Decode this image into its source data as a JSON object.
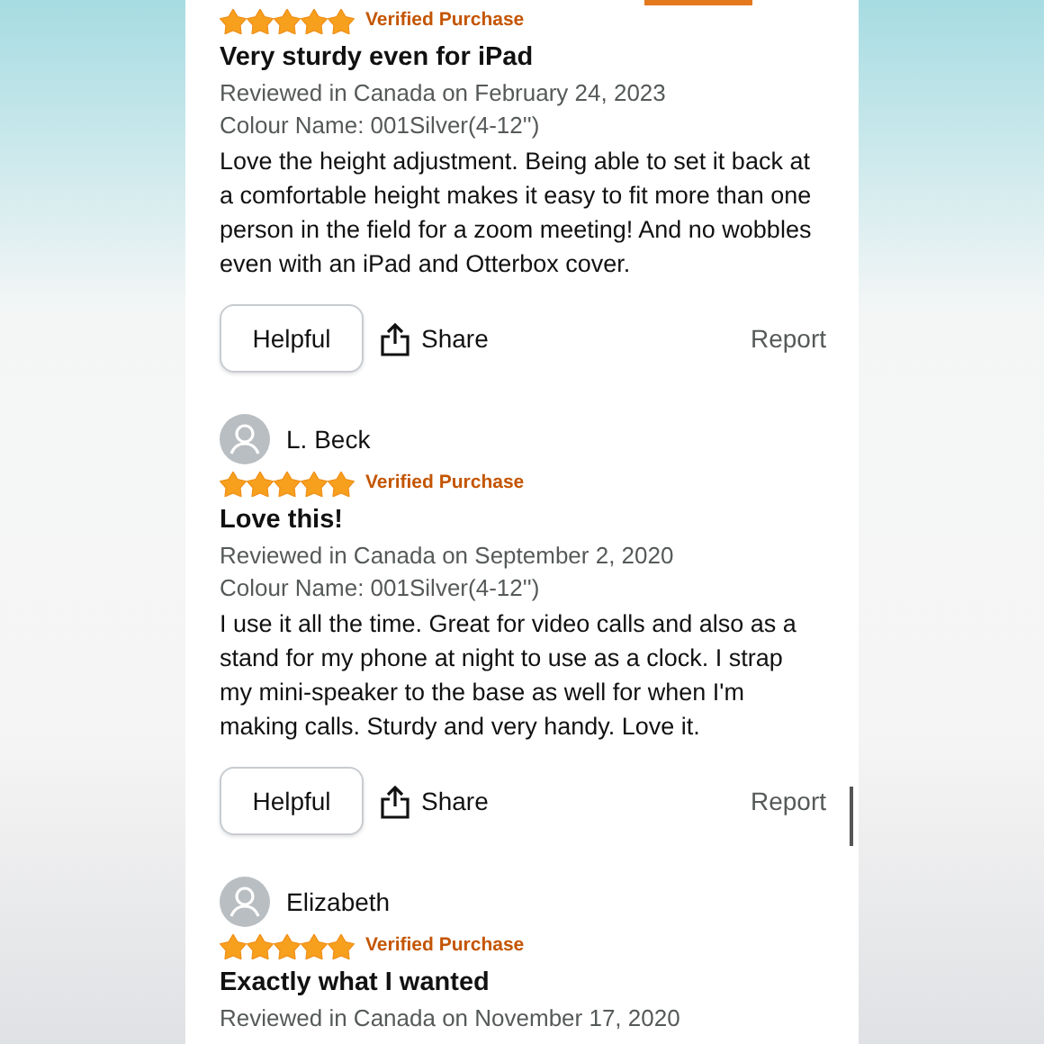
{
  "reviews": [
    {
      "stars": 5,
      "verified": "Verified Purchase",
      "title": "Very sturdy even for iPad",
      "date": "Reviewed in Canada on February 24, 2023",
      "variant": "Colour Name: 001Silver(4-12'')",
      "body": "Love the height adjustment. Being able to set it back at a comfortable height makes it easy to fit more than one person in the field for a zoom meeting! And no wobbles even with an iPad and Otterbox cover.",
      "helpful": "Helpful",
      "share": "Share",
      "report": "Report"
    },
    {
      "author": "L. Beck",
      "stars": 5,
      "verified": "Verified Purchase",
      "title": "Love this!",
      "date": "Reviewed in Canada on September 2, 2020",
      "variant": "Colour Name: 001Silver(4-12'')",
      "body": "I use it all the time. Great for video calls and also as a stand for my phone at night to use as a clock. I strap my mini-speaker to the base as well for when I'm making calls. Sturdy and very handy. Love it.",
      "helpful": "Helpful",
      "share": "Share",
      "report": "Report"
    },
    {
      "author": "Elizabeth",
      "stars": 5,
      "verified": "Verified Purchase",
      "title": "Exactly what I wanted",
      "date": "Reviewed in Canada on November 17, 2020"
    }
  ]
}
